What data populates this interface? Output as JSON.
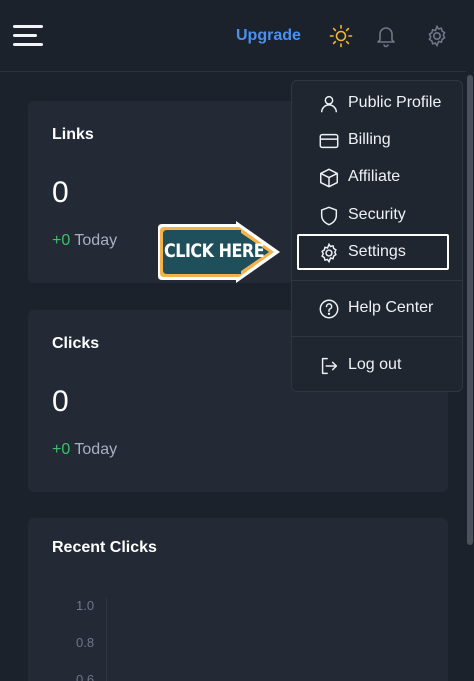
{
  "topbar": {
    "menu_icon": "hamburger-menu-icon",
    "upgrade_label": "Upgrade",
    "icons": [
      "sun-icon",
      "bell-icon",
      "gear-icon"
    ],
    "accent_color": "#4a8ff2",
    "sun_color": "#f5b82e"
  },
  "cards": [
    {
      "title": "Links",
      "value": "0",
      "delta": "+0",
      "delta_label": "Today"
    },
    {
      "title": "Clicks",
      "value": "0",
      "delta": "+0",
      "delta_label": "Today"
    },
    {
      "title": "Recent Clicks",
      "y_ticks": [
        "1.0",
        "0.8",
        "0.6"
      ]
    }
  ],
  "dropdown": {
    "items": [
      {
        "label": "Public Profile",
        "icon": "user-icon"
      },
      {
        "label": "Billing",
        "icon": "credit-card-icon"
      },
      {
        "label": "Affiliate",
        "icon": "box-icon"
      },
      {
        "label": "Security",
        "icon": "shield-icon"
      },
      {
        "label": "Settings",
        "icon": "gear-icon",
        "highlighted": true
      },
      {
        "label": "Help Center",
        "icon": "help-circle-icon"
      },
      {
        "label": "Log out",
        "icon": "log-out-icon"
      }
    ]
  },
  "callout": {
    "text": "CLICK HERE",
    "color": "#1f4f5a",
    "border_color": "#f4b24a"
  },
  "colors": {
    "background": "#1c222c",
    "card": "#232a35",
    "positive": "#3fbf6a"
  }
}
